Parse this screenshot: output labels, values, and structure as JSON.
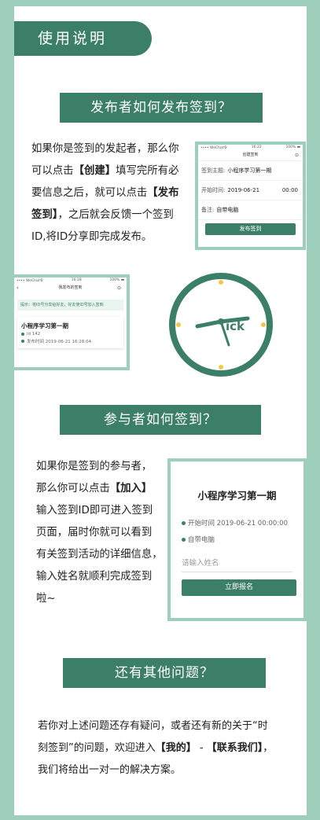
{
  "usage_title": "使用说明",
  "section1": {
    "heading": "发布者如何发布签到？",
    "lines": [
      [
        {
          "t": "如果你是签到的发起者，那么你"
        }
      ],
      [
        {
          "t": "可以点击"
        },
        {
          "t": "【创建】",
          "b": true
        },
        {
          "t": "填写完所有必"
        }
      ],
      [
        {
          "t": "要信息之后，就可以点击"
        },
        {
          "t": "【发布",
          "b": true
        }
      ],
      [
        {
          "t": "签到】",
          "b": true
        },
        {
          "t": "，之后就会反馈一个签到"
        }
      ],
      [
        {
          "t": "ID,将ID分享即完成发布。"
        }
      ]
    ]
  },
  "phone1": {
    "status_left": "•••• WeChat令",
    "status_time": "16:22",
    "status_right": "100% ▬",
    "nav_title": "创建签到",
    "nav_close": "⊙",
    "topic_label": "签到主题:",
    "topic_value": "小程序学习第一期",
    "start_label": "开始时间:",
    "start_date": "2019-06-21",
    "start_time": "00:00",
    "note_label": "备注:",
    "note_value": "自带电脑",
    "publish_button": "发布签到"
  },
  "phone2": {
    "status_left": "•••• WeChat令",
    "status_time": "16:28",
    "status_right": "100% ▬",
    "nav_back": "‹",
    "nav_title": "我发布的签到",
    "nav_close": "⊙",
    "tip": "提示：将ID号分享给好友，好友使ID号加入签到",
    "item_title": "小程序学习第一期",
    "item_id": "id 142",
    "item_time": "发布时间 2019-06-21 16:28:04"
  },
  "clock": {
    "word": "ick"
  },
  "section2": {
    "heading": "参与者如何签到？",
    "lines": [
      [
        {
          "t": "如果你是签到的参与者，"
        }
      ],
      [
        {
          "t": "那么你可以点击"
        },
        {
          "t": "【加入】",
          "b": true
        }
      ],
      [
        {
          "t": "输入签到ID即可进入签到"
        }
      ],
      [
        {
          "t": "页面，届时你就可以看到"
        }
      ],
      [
        {
          "t": "有关签到活动的详细信息，"
        }
      ],
      [
        {
          "t": "输入姓名就顺利完成签到"
        }
      ],
      [
        {
          "t": "啦~"
        }
      ]
    ]
  },
  "phone3": {
    "title": "小程序学习第一期",
    "start": "开始时间 2019-06-21 00:00:00",
    "note": "自带电脑",
    "name_placeholder": "请输入姓名",
    "signup_button": "立即报名"
  },
  "section3": {
    "heading": "还有其他问题？",
    "lines": [
      [
        {
          "t": "若你对上述问题还存有疑问，或者还有新的关于“时"
        }
      ],
      [
        {
          "t": "刻签到”的问题，欢迎进入"
        },
        {
          "t": "【我的】",
          "b": true
        },
        {
          "t": " - "
        },
        {
          "t": "【联系我们】",
          "b": true
        },
        {
          "t": "，"
        }
      ],
      [
        {
          "t": "我们将给出一对一的解决方案。"
        }
      ]
    ]
  },
  "colors": {
    "accent": "#3c7f68",
    "border": "#9ecfbd",
    "clock_dot": "#f2c84b"
  }
}
